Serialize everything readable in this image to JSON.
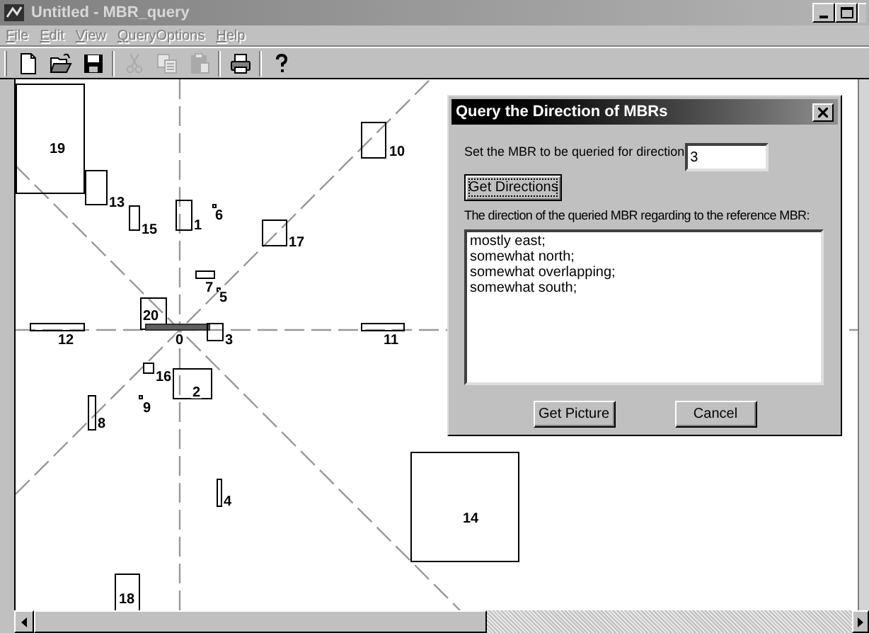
{
  "window": {
    "title": "Untitled - MBR_query"
  },
  "menu": [
    {
      "label": "File",
      "disabled": true
    },
    {
      "label": "Edit",
      "disabled": true
    },
    {
      "label": "View",
      "disabled": true
    },
    {
      "label": "QueryOptions",
      "disabled": true
    },
    {
      "label": "Help",
      "disabled": true
    }
  ],
  "toolbar": [
    {
      "kind": "new",
      "disabled": false
    },
    {
      "kind": "open",
      "disabled": false
    },
    {
      "kind": "save",
      "disabled": false
    },
    {
      "kind": "cut",
      "disabled": true
    },
    {
      "kind": "copy",
      "disabled": true
    },
    {
      "kind": "paste",
      "disabled": true
    },
    {
      "kind": "print",
      "disabled": false
    },
    {
      "kind": "help",
      "disabled": false
    }
  ],
  "canvas": {
    "mbrs": [
      {
        "label": "19",
        "kind": "mbr"
      },
      {
        "label": "10",
        "kind": "mbr"
      },
      {
        "label": "13",
        "kind": "mbr"
      },
      {
        "label": "1",
        "kind": "mbr"
      },
      {
        "label": "6",
        "kind": "mbr"
      },
      {
        "label": "15",
        "kind": "mbr"
      },
      {
        "label": "17",
        "kind": "mbr"
      },
      {
        "label": "7",
        "kind": "mbr"
      },
      {
        "label": "5",
        "kind": "mbr"
      },
      {
        "label": "20",
        "kind": "mbr"
      },
      {
        "label": "12",
        "kind": "mbr"
      },
      {
        "label": "0",
        "kind": "reference"
      },
      {
        "label": "3",
        "kind": "mbr"
      },
      {
        "label": "11",
        "kind": "mbr"
      },
      {
        "label": "16",
        "kind": "mbr"
      },
      {
        "label": "2",
        "kind": "mbr"
      },
      {
        "label": "9",
        "kind": "mbr"
      },
      {
        "label": "8",
        "kind": "mbr"
      },
      {
        "label": "14",
        "kind": "mbr"
      },
      {
        "label": "4",
        "kind": "mbr"
      },
      {
        "label": "18",
        "kind": "mbr"
      }
    ]
  },
  "dialog": {
    "title": "Query the Direction of MBRs",
    "prompt": "Set the MBR to be queried for direction",
    "mbr_value": "3",
    "get_directions": "Get Directions",
    "result_label": "The direction of the queried MBR regarding to the reference MBR:",
    "results": [
      "mostly east;",
      "somewhat north;",
      "somewhat overlapping;",
      "somewhat south;"
    ],
    "buttons": [
      "Get Picture",
      "Cancel"
    ]
  }
}
